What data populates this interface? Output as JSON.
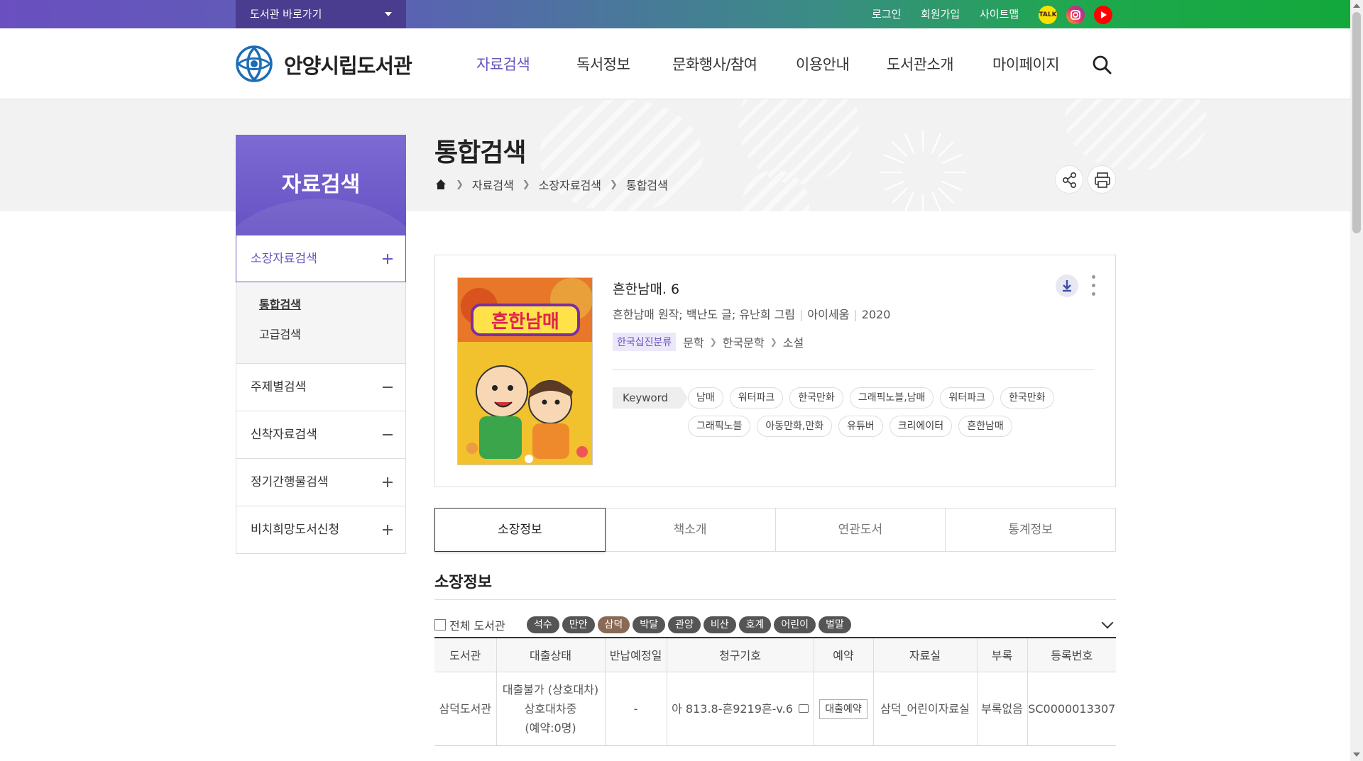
{
  "topbar": {
    "shortcut_label": "도서관 바로가기",
    "login": "로그인",
    "join": "회원가입",
    "sitemap": "사이트맵",
    "sns": [
      {
        "name": "kakaotalk-icon",
        "label": "TALK",
        "color": "#3a1d1d"
      },
      {
        "name": "instagram-icon",
        "label": "",
        "color": "#e1306c"
      },
      {
        "name": "youtube-icon",
        "label": "",
        "color": "#ff0000"
      }
    ]
  },
  "header": {
    "logo_text": "안양시립도서관",
    "gnb": [
      "자료검색",
      "독서정보",
      "문화행사/참여",
      "이용안내",
      "도서관소개",
      "마이페이지"
    ]
  },
  "lnb": {
    "title": "자료검색",
    "items": [
      {
        "label": "소장자료검색",
        "sign": "plus",
        "open": true
      },
      {
        "label": "주제별검색",
        "sign": "minus",
        "open": false
      },
      {
        "label": "신착자료검색",
        "sign": "minus",
        "open": false
      },
      {
        "label": "정기간행물검색",
        "sign": "plus",
        "open": false
      },
      {
        "label": "비치희망도서신청",
        "sign": "plus",
        "open": false
      }
    ],
    "sub_items": [
      "통합검색",
      "고급검색"
    ]
  },
  "page": {
    "title": "통합검색",
    "breadcrumb": [
      "자료검색",
      "소장자료검색",
      "통합검색"
    ]
  },
  "book": {
    "title": "흔한남매. 6",
    "author": "흔한남매 원작; 백난도 글; 유난희 그림",
    "publisher": "아이세움",
    "year": "2020",
    "class_badge": "한국십진분류",
    "class_path": [
      "문학",
      "한국문학",
      "소설"
    ],
    "keyword_label": "Keyword",
    "keywords": [
      "남매",
      "워터파크",
      "한국만화",
      "그래픽노블,남매",
      "워터파크",
      "한국만화",
      "그래픽노블",
      "아동만화,만화",
      "유튜버",
      "크리에이터",
      "흔한남매"
    ],
    "cover_title": "흔한남매"
  },
  "tabs": [
    "소장정보",
    "책소개",
    "연관도서",
    "통계정보"
  ],
  "holdings": {
    "section_title": "소장정보",
    "all_libraries_label": "전체 도서관",
    "libraries": [
      "석수",
      "만안",
      "삼덕",
      "박달",
      "관양",
      "비산",
      "호계",
      "어린이",
      "벌말"
    ],
    "selected_library": "삼덕",
    "columns": [
      "도서관",
      "대출상태",
      "반납예정일",
      "청구기호",
      "예약",
      "자료실",
      "부록",
      "등록번호"
    ],
    "rows": [
      {
        "library": "삼덕도서관",
        "status_line1": "대출불가 (상호대차)",
        "status_line2": "상호대차중",
        "status_line3": "(예약:0명)",
        "due": "-",
        "call_number": "아 813.8-흔9219흔-v.6",
        "reserve_label": "대출예약",
        "room": "삼덕_어린이자료실",
        "appendix": "부록없음",
        "reg_no": "SC0000013307"
      }
    ]
  },
  "colors": {
    "accent": "#6a55c2",
    "topbar_start": "#6a4fc0",
    "topbar_end": "#12a83c"
  }
}
